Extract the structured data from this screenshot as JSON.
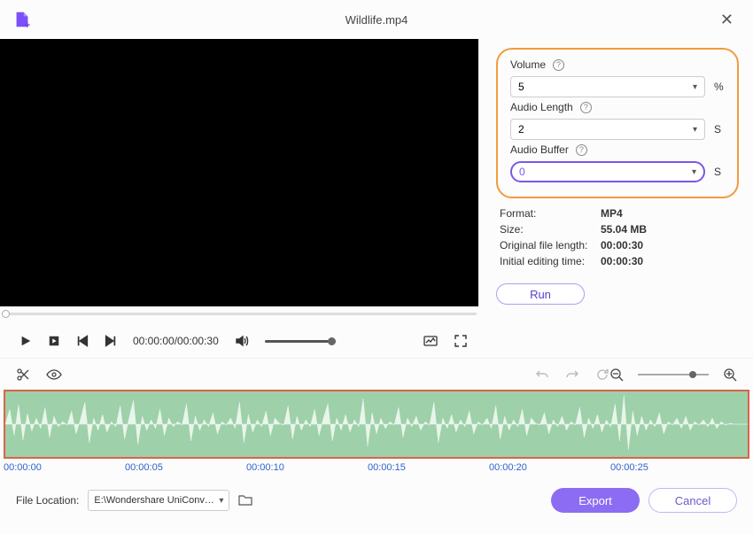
{
  "header": {
    "title": "Wildlife.mp4"
  },
  "panel": {
    "volume": {
      "label": "Volume",
      "value": "5",
      "unit": "%"
    },
    "audio_length": {
      "label": "Audio Length",
      "value": "2",
      "unit": "S"
    },
    "audio_buffer": {
      "label": "Audio Buffer",
      "value": "0",
      "unit": "S"
    },
    "info": {
      "format": {
        "label": "Format:",
        "value": "MP4"
      },
      "size": {
        "label": "Size:",
        "value": "55.04 MB"
      },
      "orig_len": {
        "label": "Original file length:",
        "value": "00:00:30"
      },
      "init_time": {
        "label": "Initial editing time:",
        "value": "00:00:30"
      }
    },
    "run_label": "Run"
  },
  "controls": {
    "time": "00:00:00/00:00:30"
  },
  "ruler": {
    "ticks": [
      "00:00:00",
      "00:00:05",
      "00:00:10",
      "00:00:15",
      "00:00:20",
      "00:00:25"
    ]
  },
  "footer": {
    "file_location_label": "File Location:",
    "path": "E:\\Wondershare UniConverter",
    "export_label": "Export",
    "cancel_label": "Cancel"
  }
}
